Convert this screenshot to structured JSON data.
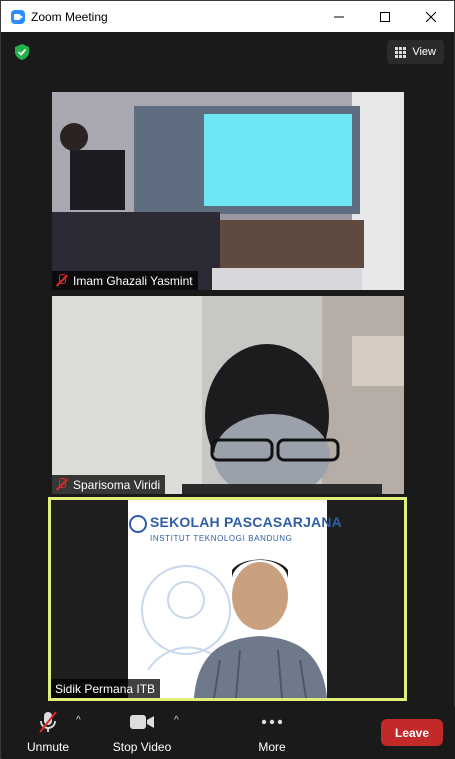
{
  "window": {
    "title": "Zoom Meeting"
  },
  "header": {
    "view_label": "View"
  },
  "participants": [
    {
      "name": "Imam Ghazali Yasmint",
      "muted": true
    },
    {
      "name": "Sparisoma Viridi",
      "muted": true
    },
    {
      "name": "Sidik Permana ITB",
      "muted": false,
      "active_speaker": true
    }
  ],
  "banner": {
    "title": "SEKOLAH PASCASARJANA",
    "subtitle": "INSTITUT TEKNOLOGI BANDUNG"
  },
  "toolbar": {
    "unmute_label": "Unmute",
    "stop_video_label": "Stop Video",
    "more_label": "More",
    "leave_label": "Leave"
  },
  "colors": {
    "accent": "#2d8cff",
    "leave": "#c22a2a",
    "active_border": "#e2f07a",
    "muted_mic": "#e02828",
    "secure_shield": "#23b14d"
  }
}
